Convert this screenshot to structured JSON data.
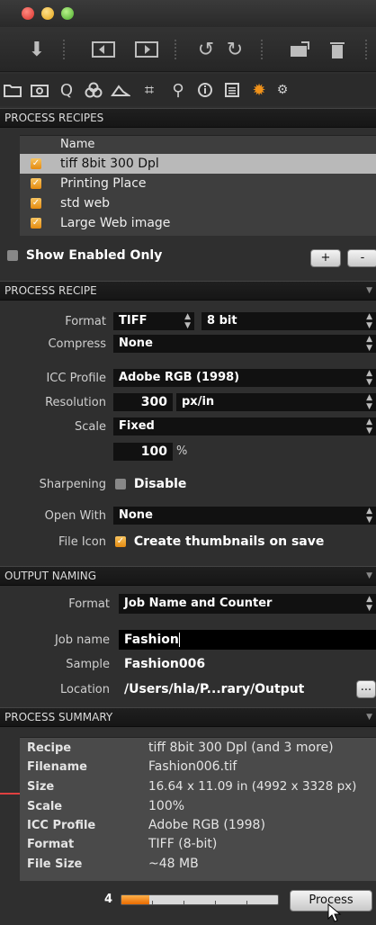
{
  "toolbar": {
    "icons": [
      "import-icon",
      "capture-left-icon",
      "capture-right-icon",
      "rotate-left-icon",
      "rotate-right-icon",
      "move-icon",
      "trash-icon"
    ]
  },
  "tooltabs": {
    "icons": [
      "folder-icon",
      "camera-icon",
      "search-icon",
      "color-icon",
      "exposure-icon",
      "crop-icon",
      "zoom-icon",
      "info-icon",
      "list-icon",
      "gear-icon",
      "settings-icon"
    ]
  },
  "recipes": {
    "header": "PROCESS RECIPES",
    "column_name": "Name",
    "items": [
      {
        "label": "tiff 8bit 300 Dpl",
        "checked": true,
        "selected": true
      },
      {
        "label": "Printing Place",
        "checked": true,
        "selected": false
      },
      {
        "label": "std web",
        "checked": true,
        "selected": false
      },
      {
        "label": "Large Web image",
        "checked": true,
        "selected": false
      }
    ],
    "show_enabled_label": "Show Enabled Only",
    "add_label": "+",
    "remove_label": "-"
  },
  "recipe": {
    "header": "PROCESS RECIPE",
    "format_label": "Format",
    "format_value": "TIFF",
    "bit_value": "8 bit",
    "compress_label": "Compress",
    "compress_value": "None",
    "icc_label": "ICC Profile",
    "icc_value": "Adobe RGB (1998)",
    "resolution_label": "Resolution",
    "resolution_value": "300",
    "resolution_unit": "px/in",
    "scale_label": "Scale",
    "scale_value": "Fixed",
    "scale_pct": "100",
    "scale_pct_unit": "%",
    "sharpening_label": "Sharpening",
    "sharpening_value": "Disable",
    "openwith_label": "Open With",
    "openwith_value": "None",
    "fileicon_label": "File Icon",
    "fileicon_value": "Create thumbnails on save"
  },
  "naming": {
    "header": "OUTPUT NAMING",
    "format_label": "Format",
    "format_value": "Job Name and Counter",
    "jobname_label": "Job name",
    "jobname_value": "Fashion",
    "sample_label": "Sample",
    "sample_value": "Fashion006",
    "location_label": "Location",
    "location_value": "/Users/hla/P...rary/Output",
    "browse_label": "..."
  },
  "summary": {
    "header": "PROCESS SUMMARY",
    "rows": [
      {
        "k": "Recipe",
        "v": "tiff 8bit 300 Dpl (and 3 more)"
      },
      {
        "k": "Filename",
        "v": "Fashion006.tif"
      },
      {
        "k": "Size",
        "v": "16.64 x 11.09 in (4992 x 3328 px)"
      },
      {
        "k": "Scale",
        "v": "100%"
      },
      {
        "k": "ICC Profile",
        "v": "Adobe RGB (1998)"
      },
      {
        "k": "Format",
        "v": "TIFF (8-bit)"
      },
      {
        "k": "File Size",
        "v": "~48 MB"
      }
    ]
  },
  "footer": {
    "queue_count": "4",
    "progress": 0.18,
    "process_label": "Process"
  },
  "colors": {
    "accent": "#f0921a",
    "selection": "#b9b9b9",
    "panel": "#2f2f2f"
  }
}
